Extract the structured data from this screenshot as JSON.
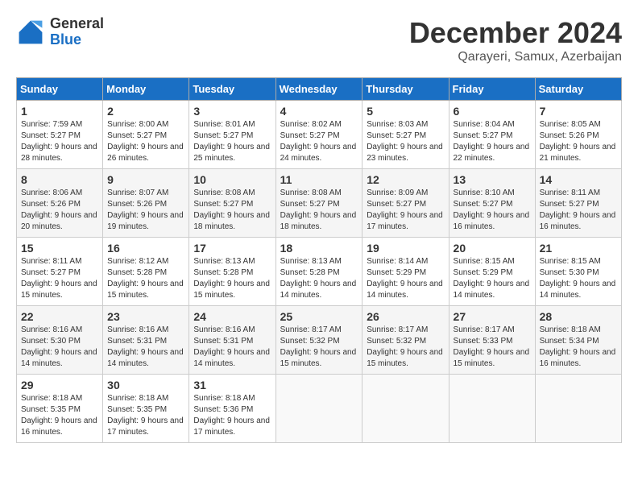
{
  "logo": {
    "general": "General",
    "blue": "Blue"
  },
  "title": "December 2024",
  "subtitle": "Qarayeri, Samux, Azerbaijan",
  "weekdays": [
    "Sunday",
    "Monday",
    "Tuesday",
    "Wednesday",
    "Thursday",
    "Friday",
    "Saturday"
  ],
  "weeks": [
    [
      {
        "day": "1",
        "sunrise": "7:59 AM",
        "sunset": "5:27 PM",
        "daylight": "9 hours and 28 minutes."
      },
      {
        "day": "2",
        "sunrise": "8:00 AM",
        "sunset": "5:27 PM",
        "daylight": "9 hours and 26 minutes."
      },
      {
        "day": "3",
        "sunrise": "8:01 AM",
        "sunset": "5:27 PM",
        "daylight": "9 hours and 25 minutes."
      },
      {
        "day": "4",
        "sunrise": "8:02 AM",
        "sunset": "5:27 PM",
        "daylight": "9 hours and 24 minutes."
      },
      {
        "day": "5",
        "sunrise": "8:03 AM",
        "sunset": "5:27 PM",
        "daylight": "9 hours and 23 minutes."
      },
      {
        "day": "6",
        "sunrise": "8:04 AM",
        "sunset": "5:27 PM",
        "daylight": "9 hours and 22 minutes."
      },
      {
        "day": "7",
        "sunrise": "8:05 AM",
        "sunset": "5:26 PM",
        "daylight": "9 hours and 21 minutes."
      }
    ],
    [
      {
        "day": "8",
        "sunrise": "8:06 AM",
        "sunset": "5:26 PM",
        "daylight": "9 hours and 20 minutes."
      },
      {
        "day": "9",
        "sunrise": "8:07 AM",
        "sunset": "5:26 PM",
        "daylight": "9 hours and 19 minutes."
      },
      {
        "day": "10",
        "sunrise": "8:08 AM",
        "sunset": "5:27 PM",
        "daylight": "9 hours and 18 minutes."
      },
      {
        "day": "11",
        "sunrise": "8:08 AM",
        "sunset": "5:27 PM",
        "daylight": "9 hours and 18 minutes."
      },
      {
        "day": "12",
        "sunrise": "8:09 AM",
        "sunset": "5:27 PM",
        "daylight": "9 hours and 17 minutes."
      },
      {
        "day": "13",
        "sunrise": "8:10 AM",
        "sunset": "5:27 PM",
        "daylight": "9 hours and 16 minutes."
      },
      {
        "day": "14",
        "sunrise": "8:11 AM",
        "sunset": "5:27 PM",
        "daylight": "9 hours and 16 minutes."
      }
    ],
    [
      {
        "day": "15",
        "sunrise": "8:11 AM",
        "sunset": "5:27 PM",
        "daylight": "9 hours and 15 minutes."
      },
      {
        "day": "16",
        "sunrise": "8:12 AM",
        "sunset": "5:28 PM",
        "daylight": "9 hours and 15 minutes."
      },
      {
        "day": "17",
        "sunrise": "8:13 AM",
        "sunset": "5:28 PM",
        "daylight": "9 hours and 15 minutes."
      },
      {
        "day": "18",
        "sunrise": "8:13 AM",
        "sunset": "5:28 PM",
        "daylight": "9 hours and 14 minutes."
      },
      {
        "day": "19",
        "sunrise": "8:14 AM",
        "sunset": "5:29 PM",
        "daylight": "9 hours and 14 minutes."
      },
      {
        "day": "20",
        "sunrise": "8:15 AM",
        "sunset": "5:29 PM",
        "daylight": "9 hours and 14 minutes."
      },
      {
        "day": "21",
        "sunrise": "8:15 AM",
        "sunset": "5:30 PM",
        "daylight": "9 hours and 14 minutes."
      }
    ],
    [
      {
        "day": "22",
        "sunrise": "8:16 AM",
        "sunset": "5:30 PM",
        "daylight": "9 hours and 14 minutes."
      },
      {
        "day": "23",
        "sunrise": "8:16 AM",
        "sunset": "5:31 PM",
        "daylight": "9 hours and 14 minutes."
      },
      {
        "day": "24",
        "sunrise": "8:16 AM",
        "sunset": "5:31 PM",
        "daylight": "9 hours and 14 minutes."
      },
      {
        "day": "25",
        "sunrise": "8:17 AM",
        "sunset": "5:32 PM",
        "daylight": "9 hours and 15 minutes."
      },
      {
        "day": "26",
        "sunrise": "8:17 AM",
        "sunset": "5:32 PM",
        "daylight": "9 hours and 15 minutes."
      },
      {
        "day": "27",
        "sunrise": "8:17 AM",
        "sunset": "5:33 PM",
        "daylight": "9 hours and 15 minutes."
      },
      {
        "day": "28",
        "sunrise": "8:18 AM",
        "sunset": "5:34 PM",
        "daylight": "9 hours and 16 minutes."
      }
    ],
    [
      {
        "day": "29",
        "sunrise": "8:18 AM",
        "sunset": "5:35 PM",
        "daylight": "9 hours and 16 minutes."
      },
      {
        "day": "30",
        "sunrise": "8:18 AM",
        "sunset": "5:35 PM",
        "daylight": "9 hours and 17 minutes."
      },
      {
        "day": "31",
        "sunrise": "8:18 AM",
        "sunset": "5:36 PM",
        "daylight": "9 hours and 17 minutes."
      },
      null,
      null,
      null,
      null
    ]
  ]
}
